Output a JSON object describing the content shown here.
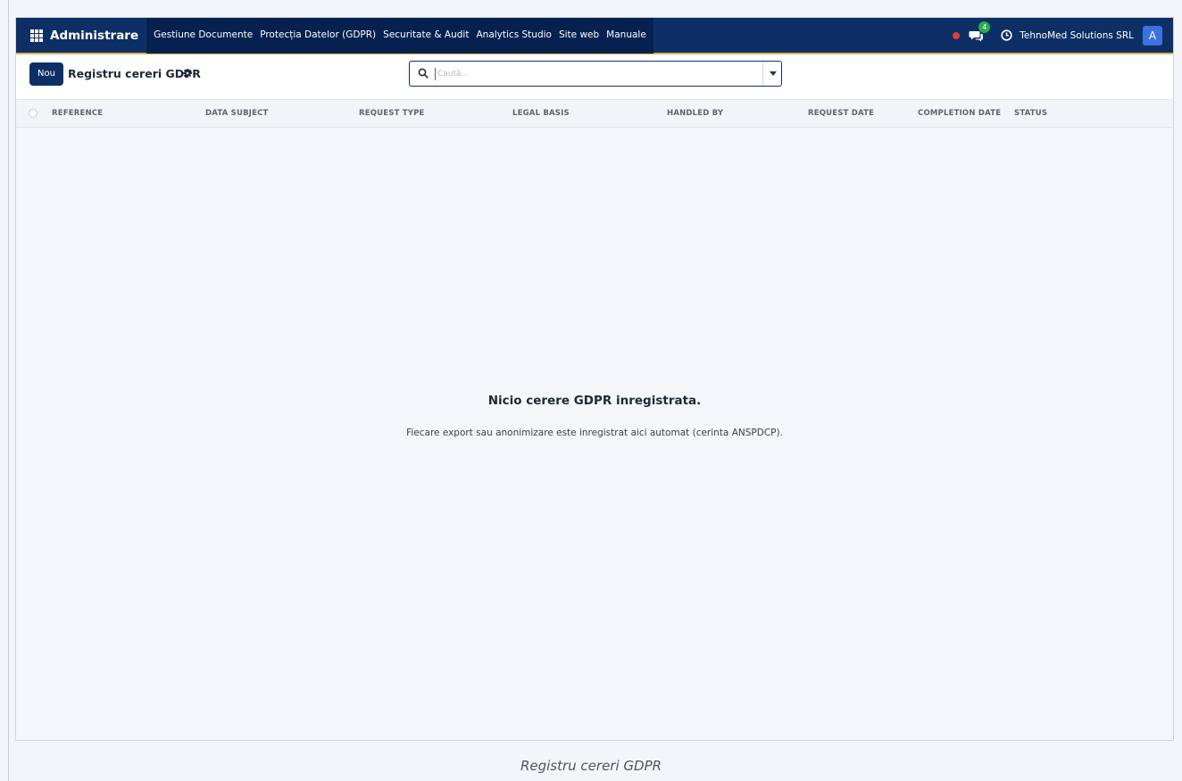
{
  "navbar": {
    "app_name": "Administrare",
    "menu": [
      {
        "label": "Gestiune Documente"
      },
      {
        "label": "Protecția Datelor (GDPR)"
      },
      {
        "label": "Securitate & Audit"
      },
      {
        "label": "Analytics Studio"
      },
      {
        "label": "Site web"
      },
      {
        "label": "Manuale"
      }
    ],
    "message_count": "4",
    "company": "TehnoMed Solutions SRL",
    "user_initial": "A",
    "colors": {
      "bar": "#0e2f66",
      "accent": "#d8b54a",
      "badge": "#2fa84f",
      "recording": "#e23b3b",
      "avatar": "#3b72e0"
    }
  },
  "control_panel": {
    "new_button": "Nou",
    "title": "Registru cereri GDPR",
    "search_placeholder": "Caută..."
  },
  "table": {
    "columns": [
      "REFERENCE",
      "DATA SUBJECT",
      "REQUEST TYPE",
      "LEGAL BASIS",
      "HANDLED BY",
      "REQUEST DATE",
      "COMPLETION DATE",
      "STATUS"
    ],
    "rows": []
  },
  "empty_state": {
    "title": "Nicio cerere GDPR inregistrata.",
    "subtitle": "Fiecare export sau anonimizare este inregistrat aici automat (cerinta ANSPDCP)."
  },
  "caption": "Registru cereri GDPR"
}
